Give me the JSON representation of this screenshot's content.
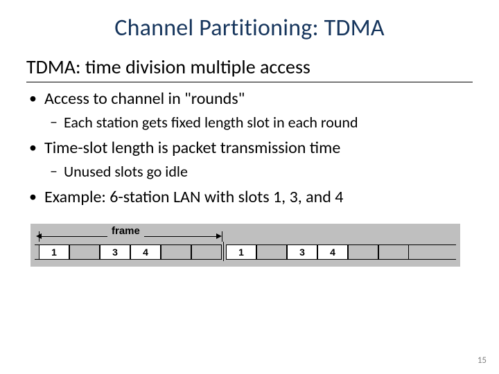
{
  "title": "Channel Partitioning: TDMA",
  "subtitle": "TDMA: time division multiple access",
  "bullets": {
    "b1": "Access to channel in \"rounds\"",
    "b1a": "Each station gets fixed length slot in each round",
    "b2": "Time-slot length is packet transmission time",
    "b2a": "Unused slots go idle",
    "b3": "Example: 6-station LAN with slots 1, 3, and 4"
  },
  "diagram": {
    "frame_label": "frame",
    "slots_round1": [
      "1",
      "",
      "3",
      "4",
      "",
      ""
    ],
    "slots_round2": [
      "1",
      "",
      "3",
      "4",
      "",
      ""
    ]
  },
  "page_number": "15"
}
